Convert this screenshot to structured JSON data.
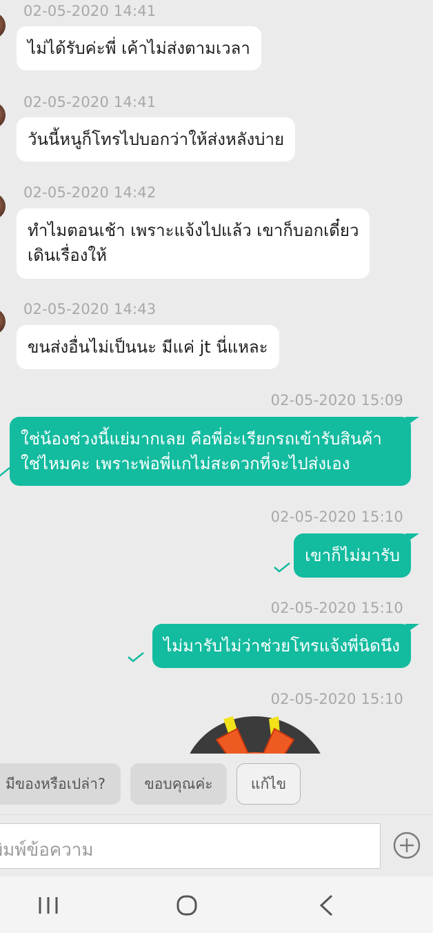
{
  "messages": [
    {
      "direction": "in",
      "time": "02-05-2020 14:41",
      "lines": [
        "ไม่ได้รับค่ะพี่ เค้าไม่ส่งตามเวลา"
      ]
    },
    {
      "direction": "in",
      "time": "02-05-2020 14:41",
      "lines": [
        "วันนี้หนูก็โทรไปบอกว่าให้ส่งหลังบ่าย"
      ]
    },
    {
      "direction": "in",
      "time": "02-05-2020 14:42",
      "lines": [
        "ทำไมตอนเช้า เพราะแจ้งไปแล้ว เขาก็บอกเดี๋ยว",
        "เดินเรื่องให้"
      ]
    },
    {
      "direction": "in",
      "time": "02-05-2020 14:43",
      "lines": [
        "ขนส่งอื่นไม่เป็นนะ มีแค่ jt นี่แหละ"
      ]
    },
    {
      "direction": "out",
      "time": "02-05-2020 15:09",
      "lines": [
        "ใช่น้องช่วงนี้แย่มากเลย คือพี่อ่ะเรียกรถเข้ารับสินค้า",
        "ใช่ไหมคะ เพราะพ่อพี่แกไม่สะดวกที่จะไปส่งเอง"
      ],
      "status_icon": "read-check-icon"
    },
    {
      "direction": "out",
      "time": "02-05-2020 15:10",
      "lines": [
        "เขาก็ไม่มารับ"
      ],
      "status_icon": "read-check-icon"
    },
    {
      "direction": "out",
      "time": "02-05-2020 15:10",
      "lines": [
        "ไม่มารับไม่ว่าช่วยโทรแจ้งพี่นิดนึง"
      ],
      "status_icon": "read-check-icon"
    },
    {
      "direction": "out",
      "time": "02-05-2020 15:10",
      "sticker": "cat-sticker"
    }
  ],
  "quick_replies": [
    "มีของหรือเปล่า?",
    "ขอบคุณค่ะ",
    "แก้ไข"
  ],
  "composer": {
    "placeholder": "พิมพ์ข้อความ",
    "add_icon": "plus-circle-icon"
  },
  "navigation": {
    "recent_icon": "recent-apps-icon",
    "home_icon": "home-icon",
    "back_icon": "back-icon"
  },
  "colors": {
    "outgoing_bubble": "#13bb9f",
    "incoming_bubble": "#ffffff",
    "background": "#ebebeb",
    "timestamp": "#a8a8a8"
  }
}
